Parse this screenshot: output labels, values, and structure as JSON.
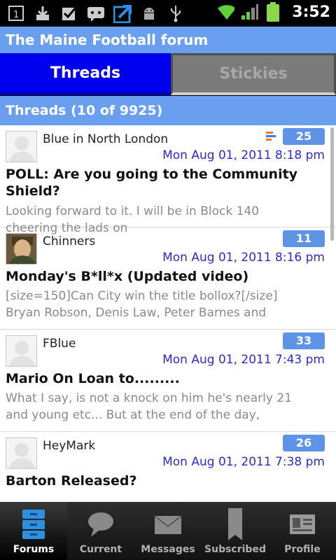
{
  "status_bar": {
    "time": "3:52",
    "notification_icons": [
      "sim-1-icon",
      "download-icon",
      "checkbox-icon",
      "sms-icon",
      "update-arrow-icon",
      "android-icon",
      "usb-icon"
    ],
    "system_icons": [
      "wifi-icon",
      "signal-icon",
      "battery-icon"
    ]
  },
  "header": {
    "title": "The Maine Football forum"
  },
  "tabs": [
    {
      "label": "Threads",
      "active": true
    },
    {
      "label": "Stickies",
      "active": false
    }
  ],
  "section": {
    "title": "Threads (10 of 9925)"
  },
  "threads": [
    {
      "author": "Blue in North London",
      "count": "25",
      "date": "Mon Aug 01, 2011 8:18 pm",
      "has_poll": true,
      "title": "POLL: Are you going to the Community Shield?",
      "preview_1": "Looking forward to it. I will be in Block 140",
      "preview_2": "cheering the lads on",
      "avatar": "default-avatar"
    },
    {
      "author": "Chinners",
      "count": "11",
      "date": "Mon Aug 01, 2011 8:16 pm",
      "has_poll": false,
      "title": "Monday's B*ll*x (Updated video)",
      "preview_1": "[size=150]Can City win the title bollox?[/size]",
      "preview_2": "Bryan Robson, Denis Law, Peter Barnes and",
      "avatar": "photo-avatar"
    },
    {
      "author": "FBlue",
      "count": "33",
      "date": "Mon Aug 01, 2011 7:43 pm",
      "has_poll": false,
      "title": "Mario On Loan to.........",
      "preview_1": "What I say, is not a knock on him he's nearly 21",
      "preview_2": "and young etc...  But at the end of the day,",
      "avatar": "default-avatar"
    },
    {
      "author": "HeyMark",
      "count": "26",
      "date": "Mon Aug 01, 2011 7:38 pm",
      "has_poll": false,
      "title": "Barton Released?",
      "preview_1": "",
      "preview_2": "",
      "avatar": "default-avatar"
    }
  ],
  "bottom_nav": [
    {
      "label": "Forums",
      "icon": "forums-icon",
      "active": true
    },
    {
      "label": "Current",
      "icon": "current-icon",
      "active": false
    },
    {
      "label": "Messages",
      "icon": "messages-icon",
      "active": false
    },
    {
      "label": "Subscribed",
      "icon": "subscribed-icon",
      "active": false
    },
    {
      "label": "Profile",
      "icon": "profile-icon",
      "active": false
    }
  ],
  "colors": {
    "header_blue": "#6a9ff0",
    "tab_active": "#0000ee",
    "date_blue": "#2a2acd",
    "badge_blue": "#5f93e6"
  }
}
